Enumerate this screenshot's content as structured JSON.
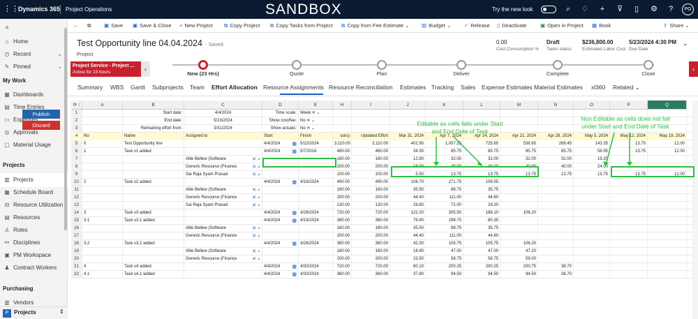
{
  "topbar": {
    "app": "Dynamics 365",
    "module": "Project Operations",
    "banner": "SANDBOX",
    "new_look": "Try the new look",
    "avatar": "PG"
  },
  "nav": {
    "items_top": [
      {
        "icon": "home-icon",
        "label": "Home"
      },
      {
        "icon": "clock-icon",
        "label": "Recent",
        "chev": "⌄"
      },
      {
        "icon": "pin-icon",
        "label": "Pinned",
        "chev": "⌄"
      }
    ],
    "section_mywork": "My Work",
    "mywork": [
      {
        "label": "Dashboards"
      },
      {
        "label": "Time Entries"
      },
      {
        "label": "Expenses"
      },
      {
        "label": "Approvals"
      },
      {
        "label": "Material Usage"
      }
    ],
    "section_projects": "Projects",
    "projects": [
      {
        "label": "Projects"
      },
      {
        "label": "Schedule Board"
      },
      {
        "label": "Resource Utilization"
      },
      {
        "label": "Resources"
      },
      {
        "label": "Roles"
      },
      {
        "label": "Disciplines"
      },
      {
        "label": "PM Workspace"
      },
      {
        "label": "Contract Workers"
      }
    ],
    "section_purchasing": "Purchasing",
    "purchasing": [
      {
        "label": "Vendors"
      }
    ],
    "area": "Projects"
  },
  "commands": [
    "Save",
    "Save & Close",
    "New Project",
    "Copy Project",
    "Copy Tasks from Project",
    "Copy from Fee Estimate",
    "Budget",
    "Release",
    "Deactivate",
    "Open in Project",
    "Book",
    "Share"
  ],
  "record": {
    "title": "Test Opportunity line 04.04.2024",
    "saved": "- Saved",
    "entity": "Project",
    "fields": [
      {
        "value": "0.00",
        "label": "Cost Consumption %"
      },
      {
        "value": "Draft",
        "label": "Tasks status"
      },
      {
        "value": "$236,800.00",
        "label": "Estimated Labor Cost"
      },
      {
        "value": "5/23/2024 4:30 PM",
        "label": "Due Date"
      }
    ]
  },
  "bpf": {
    "flag_title": "Project Service - Project ...",
    "flag_sub": "Active for 23 hours",
    "stages": [
      "New  (23 Hrs)",
      "Quote",
      "Plan",
      "Deliver",
      "Complete",
      "Close"
    ]
  },
  "tabs": [
    "Summary",
    "WBS",
    "Gantt",
    "Subprojects",
    "Team",
    "Effort Allocation",
    "Resource Assignments",
    "Resource Reconciliation",
    "Estimates",
    "Tracking",
    "Sales",
    "Expense Estimates",
    "Material Estimates",
    "xl360",
    "Related ⌄"
  ],
  "grid": {
    "columns": [
      "A",
      "B",
      "C",
      "D",
      "E",
      "H",
      "I",
      "J",
      "K",
      "L",
      "M",
      "N",
      "O",
      "P",
      "Q"
    ],
    "buttons": {
      "publish": "Publish",
      "discard": "Discard"
    },
    "params": [
      {
        "label": "Start date:",
        "value": "4/4/2024",
        "label2": "Time scale:",
        "value2": "Week"
      },
      {
        "label": "End date:",
        "value": "5/23/2024",
        "label2": "Show cost/fee:",
        "value2": "No"
      },
      {
        "label": "Remaining effort from:",
        "value": "3/31/2024",
        "label2": "Show actuals:",
        "value2": "No"
      }
    ],
    "header_row": [
      "No",
      "Name",
      "Assigned to",
      "Start",
      "Finish",
      "ours)",
      "Updated Effort",
      "Mar 31, 2024",
      "Apr 7, 2024",
      "Apr 14, 2024",
      "Apr 21, 2024",
      "Apr 28, 2024",
      "May 5, 2024",
      "May 12, 2024",
      "May 19, 2024"
    ],
    "rows": [
      [
        "5",
        "0",
        "Test Opportunity line",
        "",
        "4/4/2024",
        "5/22/2024",
        "3,110.00",
        "3,110.00",
        "402.90",
        "1,007.25",
        "725.65",
        "536.65",
        "268.45",
        "143.35",
        "13.75",
        "12.00"
      ],
      [
        "6",
        "1",
        "Task v1 added",
        "",
        "4/4/2024",
        "5/7/2024",
        "460.00",
        "460.00",
        "34.30",
        "85.75",
        "85.75",
        "85.75",
        "85.75",
        "56.95",
        "13.75",
        "12.00"
      ],
      [
        "7",
        "",
        "",
        "Allie Bellew (Software",
        "",
        "",
        "160.00",
        "160.00",
        "12.80",
        "32.00",
        "32.00",
        "32.00",
        "32.00",
        "19.20",
        "",
        ""
      ],
      [
        "8",
        "",
        "",
        "Generic Resource (Finance",
        "",
        "",
        "200.00",
        "200.00",
        "16.00",
        "40.00",
        "40.00",
        "40.00",
        "40.00",
        "24.00",
        "",
        ""
      ],
      [
        "9",
        "",
        "",
        "Sai Raja Syam Prasad",
        "",
        "",
        "100.00",
        "100.00",
        "5.50",
        "13.75",
        "13.75",
        "13.75",
        "13.75",
        "13.75",
        "13.75",
        "12.00"
      ],
      [
        "10",
        "2",
        "Task v2 added",
        "",
        "4/4/2024",
        "4/16/2024",
        "490.00",
        "490.00",
        "108.70",
        "271.75",
        "109.55",
        "",
        "",
        "",
        "",
        ""
      ],
      [
        "11",
        "",
        "",
        "Allie Bellew (Software",
        "",
        "",
        "160.00",
        "160.00",
        "35.50",
        "88.75",
        "35.75",
        "",
        "",
        "",
        "",
        ""
      ],
      [
        "12",
        "",
        "",
        "Generic Resource (Finance",
        "",
        "",
        "200.00",
        "200.00",
        "44.40",
        "111.00",
        "44.60",
        "",
        "",
        "",
        "",
        ""
      ],
      [
        "13",
        "",
        "",
        "Sai Raja Syam Prasad",
        "",
        "",
        "130.00",
        "130.00",
        "28.80",
        "72.00",
        "29.20",
        "",
        "",
        "",
        "",
        ""
      ],
      [
        "14",
        "3",
        "Task v3 added",
        "",
        "4/4/2024",
        "4/26/2024",
        "720.00",
        "720.00",
        "122.20",
        "305.50",
        "186.10",
        "106.20",
        "",
        "",
        "",
        ""
      ],
      [
        "15",
        "3.1",
        "Task v3.1 added",
        "",
        "4/4/2024",
        "4/16/2024",
        "360.00",
        "360.00",
        "79.90",
        "199.75",
        "80.35",
        "",
        "",
        "",
        "",
        ""
      ],
      [
        "16",
        "",
        "",
        "Allie Bellew (Software",
        "",
        "",
        "160.00",
        "160.00",
        "35.50",
        "88.75",
        "35.75",
        "",
        "",
        "",
        "",
        ""
      ],
      [
        "17",
        "",
        "",
        "Generic Resource (Finance",
        "",
        "",
        "200.00",
        "200.00",
        "44.40",
        "111.00",
        "44.60",
        "",
        "",
        "",
        "",
        ""
      ],
      [
        "18",
        "3.2",
        "Task v3.2 added",
        "",
        "4/4/2024",
        "4/26/2024",
        "360.00",
        "360.00",
        "42.30",
        "105.75",
        "105.75",
        "106.20",
        "",
        "",
        "",
        ""
      ],
      [
        "19",
        "",
        "",
        "Allie Bellew (Software",
        "",
        "",
        "160.00",
        "160.00",
        "18.80",
        "47.00",
        "47.00",
        "47.20",
        "",
        "",
        "",
        ""
      ],
      [
        "20",
        "",
        "",
        "Generic Resource (Finance",
        "",
        "",
        "200.00",
        "200.00",
        "23.50",
        "58.75",
        "58.75",
        "59.00",
        "",
        "",
        "",
        ""
      ],
      [
        "21",
        "4",
        "Task v4 added",
        "",
        "4/4/2024",
        "4/30/2024",
        "720.00",
        "720.00",
        "80.10",
        "200.25",
        "200.25",
        "200.75",
        "38.70",
        "",
        "",
        ""
      ],
      [
        "22",
        "4.1",
        "Task v4.1 added",
        "",
        "4/4/2024",
        "4/30/2024",
        "360.00",
        "360.00",
        "37.80",
        "94.50",
        "94.50",
        "94.50",
        "38.70",
        "",
        "",
        ""
      ]
    ]
  },
  "annotations": {
    "editable": "Editable as cells falls under Start and End Date of Task",
    "noneditable": "Non Editable as cells does not fall under Start and End Date of Task"
  }
}
